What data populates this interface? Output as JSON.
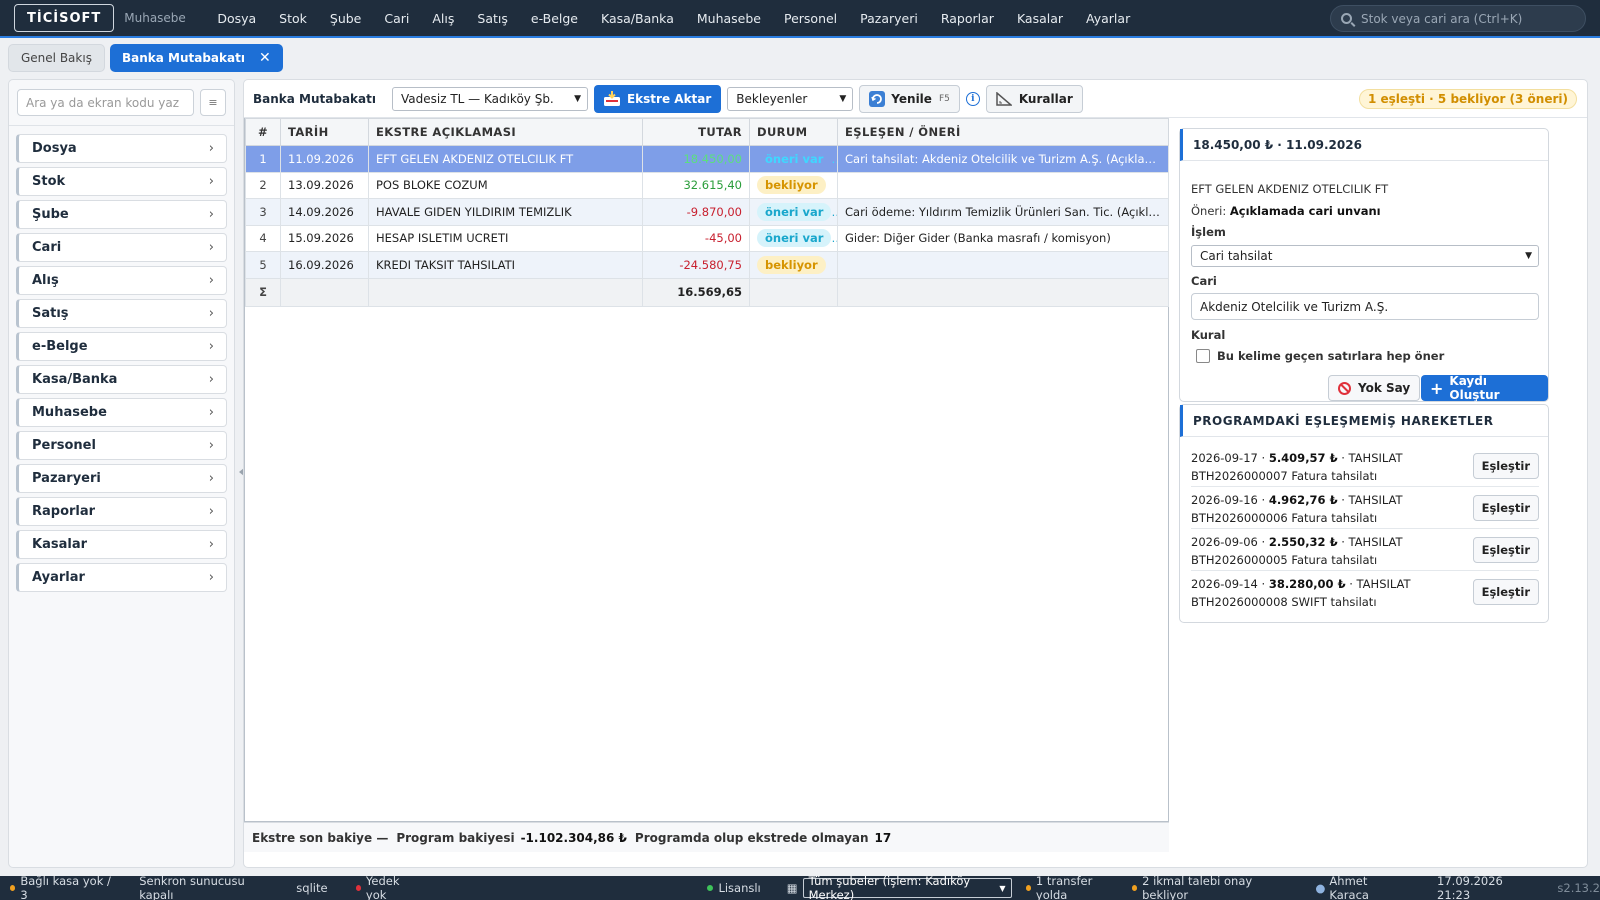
{
  "app": {
    "logo": "TİCİSOFT",
    "module": "Muhasebe",
    "nav": [
      "Dosya",
      "Stok",
      "Şube",
      "Cari",
      "Alış",
      "Satış",
      "e-Belge",
      "Kasa/Banka",
      "Muhasebe",
      "Personel",
      "Pazaryeri",
      "Raporlar",
      "Kasalar",
      "Ayarlar"
    ],
    "search_placeholder": "Stok veya cari ara (Ctrl+K)"
  },
  "tabs": [
    {
      "label": "Genel Bakış",
      "active": false
    },
    {
      "label": "Banka Mutabakatı",
      "active": true
    }
  ],
  "sidebar": {
    "search_placeholder": "Ara ya da ekran kodu yaz",
    "items": [
      "Dosya",
      "Stok",
      "Şube",
      "Cari",
      "Alış",
      "Satış",
      "e-Belge",
      "Kasa/Banka",
      "Muhasebe",
      "Personel",
      "Pazaryeri",
      "Raporlar",
      "Kasalar",
      "Ayarlar"
    ]
  },
  "toolbar": {
    "title": "Banka Mutabakatı",
    "account_select": "Vadesiz TL — Kadıköy Şb.",
    "import_label": "Ekstre Aktar",
    "filter_select": "Bekleyenler",
    "refresh_label": "Yenile",
    "refresh_key": "F5",
    "info": "i",
    "rules_label": "Kurallar",
    "status": "1 eşleşti · 5 bekliyor (3 öneri)"
  },
  "table": {
    "headers": [
      "#",
      "TARİH",
      "EKSTRE AÇIKLAMASI",
      "TUTAR",
      "DURUM",
      "EŞLEŞEN / ÖNERİ"
    ],
    "rows": [
      {
        "no": "1",
        "date": "11.09.2026",
        "desc": "EFT GELEN AKDENIZ OTELCILIK FT",
        "amount": "18.450,00",
        "status": "öneri var",
        "match": "Cari tahsilat: Akdeniz Otelcilik ve Turizm A.Ş. (Açıklamada cari unvanı)"
      },
      {
        "no": "2",
        "date": "13.09.2026",
        "desc": "POS BLOKE COZUM",
        "amount": "32.615,40",
        "status": "bekliyor",
        "match": ""
      },
      {
        "no": "3",
        "date": "14.09.2026",
        "desc": "HAVALE GIDEN YILDIRIM TEMIZLIK",
        "amount": "-9.870,00",
        "status": "öneri var",
        "match": "Cari ödeme: Yıldırım Temizlik Ürünleri San. Tic. (Açıklamada cari unvanı)"
      },
      {
        "no": "4",
        "date": "15.09.2026",
        "desc": "HESAP ISLETIM UCRETI",
        "amount": "-45,00",
        "status": "öneri var",
        "match": "Gider: Diğer Gider (Banka masrafı / komisyon)"
      },
      {
        "no": "5",
        "date": "16.09.2026",
        "desc": "KREDI TAKSIT TAHSILATI",
        "amount": "-24.580,75",
        "status": "bekliyor",
        "match": ""
      }
    ],
    "sum_symbol": "Σ",
    "sum_amount": "16.569,65"
  },
  "footer": {
    "stmt_label": "Ekstre son bakiye —",
    "program_label": "Program bakiyesi",
    "program_value": "-1.102.304,86 ₺",
    "missing_label": "Programda olup ekstrede olmayan",
    "missing_value": "17"
  },
  "detail": {
    "header": "18.450,00 ₺ · 11.09.2026",
    "desc": "EFT GELEN AKDENIZ OTELCILIK FT",
    "suggest_prefix": "Öneri:",
    "suggest_value": "Açıklamada cari unvanı",
    "islem_label": "İşlem",
    "islem_value": "Cari tahsilat",
    "cari_label": "Cari",
    "cari_value": "Akdeniz Otelcilik ve Turizm A.Ş.",
    "kural_label": "Kural",
    "kural_checkbox": "Bu kelime geçen satırlara hep öner",
    "ignore_label": "Yok Say",
    "create_label": "Kaydı Oluştur"
  },
  "unmatched": {
    "header": "PROGRAMDAKİ EŞLEŞMEMİŞ HAREKETLER",
    "items": [
      {
        "date": "2026-09-17",
        "amount": "5.409,57 ₺",
        "type": "TAHSILAT",
        "ref": "BTH2026000007 Fatura tahsilatı"
      },
      {
        "date": "2026-09-16",
        "amount": "4.962,76 ₺",
        "type": "TAHSILAT",
        "ref": "BTH2026000006 Fatura tahsilatı"
      },
      {
        "date": "2026-09-06",
        "amount": "2.550,32 ₺",
        "type": "TAHSILAT",
        "ref": "BTH2026000005 Fatura tahsilatı"
      },
      {
        "date": "2026-09-14",
        "amount": "38.280,00 ₺",
        "type": "TAHSILAT",
        "ref": "BTH2026000008 SWIFT tahsilatı"
      }
    ],
    "button_label": "Eşleştir"
  },
  "statusbar": {
    "kasa": "Bağlı kasa yok / 3",
    "sync": "Senkron sunucusu kapalı",
    "db": "sqlite",
    "backup": "Yedek yok",
    "license": "Lisanslı",
    "branch": "Tüm şubeler (işlem: Kadıköy Merkez)",
    "transfer": "1 transfer yolda",
    "ikmal": "2 ikmal talebi onay bekliyor",
    "user": "Ahmet Karaca",
    "datetime": "17.09.2026 21:23",
    "version": "s2.13.2"
  },
  "colors": {
    "navbar": "#1f2d3d",
    "accent": "#1d6fd6",
    "positive": "#2a9d3a",
    "negative": "#c8202f",
    "pending": "#d69400",
    "suggestion": "#19a7cc"
  }
}
